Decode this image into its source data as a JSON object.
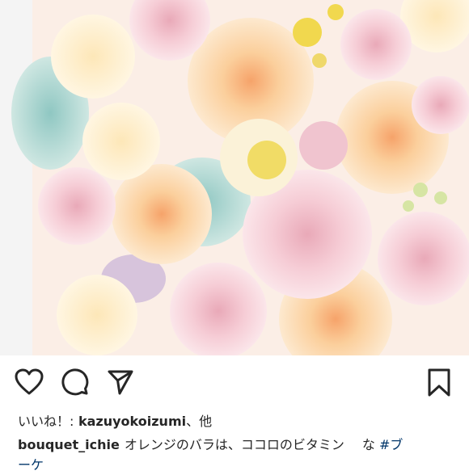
{
  "post": {
    "image_alt": "Pastel rose bouquet with peach, pink and blue flowers",
    "likes_prefix": "いいね！:",
    "likes_user": "kazuyokoizumi",
    "likes_suffix": "、他",
    "author": "bouquet_ichie",
    "caption_text": "オレンジのバラは、ココロのビタミン",
    "caption_tail": "な",
    "hashtag_line1": "#ブ",
    "hashtag_line2": "ーケ"
  },
  "icons": {
    "like": "heart-icon",
    "comment": "comment-icon",
    "share": "send-icon",
    "save": "bookmark-icon"
  },
  "colors": {
    "text": "#262626",
    "hashtag": "#003569",
    "background": "#ffffff"
  }
}
